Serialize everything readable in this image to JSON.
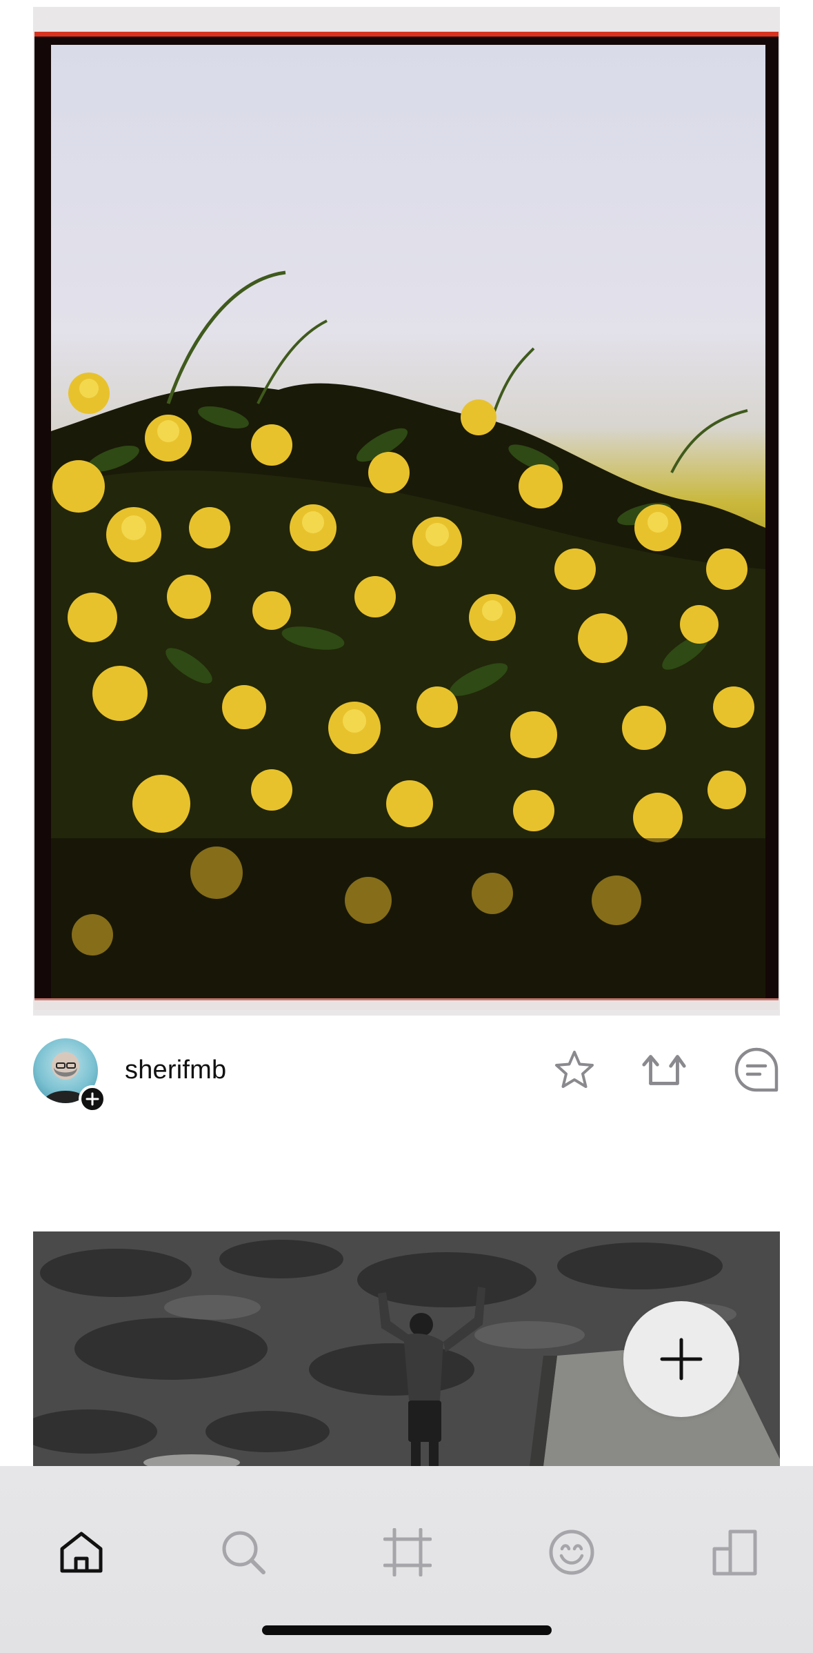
{
  "feed": {
    "post": {
      "photo_icon": "film-photo-flowers",
      "author": {
        "username": "sherifmb",
        "avatar_icon": "avatar",
        "follow_icon": "plus-icon"
      },
      "actions": {
        "favorite_icon": "star-icon",
        "repost_icon": "repost-icon",
        "comment_icon": "comment-icon"
      }
    },
    "next_post": {
      "photo_icon": "bw-photo-swimmer"
    }
  },
  "fab": {
    "icon": "plus-icon"
  },
  "tab_bar": {
    "tabs": [
      {
        "name": "home",
        "icon": "home-icon",
        "active": true
      },
      {
        "name": "search",
        "icon": "search-icon",
        "active": false
      },
      {
        "name": "crop",
        "icon": "crop-icon",
        "active": false
      },
      {
        "name": "emoji",
        "icon": "smiley-icon",
        "active": false
      },
      {
        "name": "profile",
        "icon": "building-icon",
        "active": false
      }
    ]
  },
  "colors": {
    "active_icon": "#111111",
    "inactive_icon": "#a6a6aa",
    "tab_bar_bg": "#e4e4e6",
    "film_border": "#d8331f"
  }
}
